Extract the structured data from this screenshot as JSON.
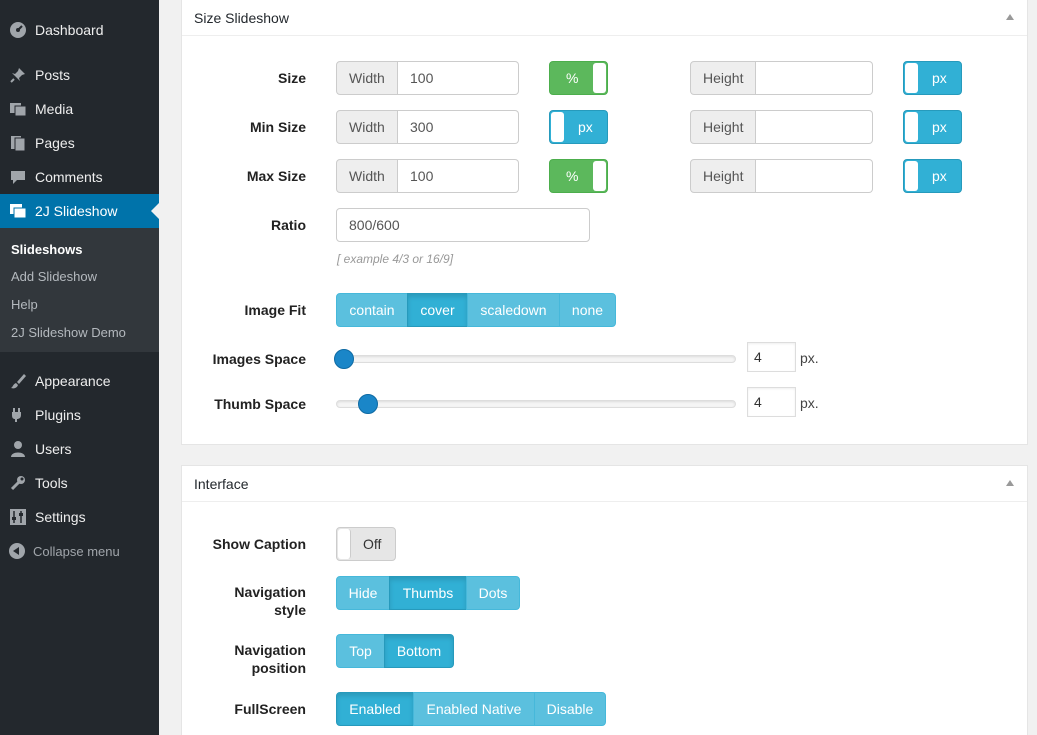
{
  "sidebar": {
    "items": [
      {
        "label": "Dashboard",
        "icon": "dashboard-icon"
      },
      {
        "label": "Posts",
        "icon": "pin-icon"
      },
      {
        "label": "Media",
        "icon": "media-icon"
      },
      {
        "label": "Pages",
        "icon": "pages-icon"
      },
      {
        "label": "Comments",
        "icon": "comment-icon"
      },
      {
        "label": "2J Slideshow",
        "icon": "slideshow-icon"
      },
      {
        "label": "Appearance",
        "icon": "brush-icon"
      },
      {
        "label": "Plugins",
        "icon": "plugin-icon"
      },
      {
        "label": "Users",
        "icon": "user-icon"
      },
      {
        "label": "Tools",
        "icon": "wrench-icon"
      },
      {
        "label": "Settings",
        "icon": "settings-icon"
      }
    ],
    "submenu": [
      "Slideshows",
      "Add Slideshow",
      "Help",
      "2J Slideshow Demo"
    ],
    "collapse": "Collapse menu"
  },
  "size_panel": {
    "title": "Size Slideshow",
    "size": {
      "label": "Size",
      "width_addon": "Width",
      "width_value": "100",
      "width_unit": "%",
      "height_addon": "Height",
      "height_value": "",
      "height_unit": "px"
    },
    "min_size": {
      "label": "Min Size",
      "width_addon": "Width",
      "width_value": "300",
      "width_unit": "px",
      "height_addon": "Height",
      "height_value": "",
      "height_unit": "px"
    },
    "max_size": {
      "label": "Max Size",
      "width_addon": "Width",
      "width_value": "100",
      "width_unit": "%",
      "height_addon": "Height",
      "height_value": "",
      "height_unit": "px"
    },
    "ratio": {
      "label": "Ratio",
      "value": "800/600",
      "hint": "[ example 4/3 or 16/9]"
    },
    "image_fit": {
      "label": "Image Fit",
      "options": [
        "contain",
        "cover",
        "scaledown",
        "none"
      ],
      "selected": "cover"
    },
    "images_space": {
      "label": "Images Space",
      "value": "4",
      "unit": "px.",
      "level": 0
    },
    "thumb_space": {
      "label": "Thumb Space",
      "value": "4",
      "unit": "px.",
      "level": 0.06
    }
  },
  "interface_panel": {
    "title": "Interface",
    "show_caption": {
      "label": "Show Caption",
      "value": "Off"
    },
    "nav_style": {
      "label_line1": "Navigation",
      "label_line2": "style",
      "options": [
        "Hide",
        "Thumbs",
        "Dots"
      ],
      "selected": "Thumbs"
    },
    "nav_position": {
      "label_line1": "Navigation",
      "label_line2": "position",
      "options": [
        "Top",
        "Bottom"
      ],
      "selected": "Bottom"
    },
    "fullscreen": {
      "label": "FullScreen",
      "options": [
        "Enabled",
        "Enabled Native",
        "Disable"
      ],
      "selected": "Enabled"
    }
  },
  "colors": {
    "sidebar_bg": "#23282d",
    "active_menu": "#0073aa",
    "info_btn": "#5bc0de",
    "success": "#5cb85c"
  }
}
